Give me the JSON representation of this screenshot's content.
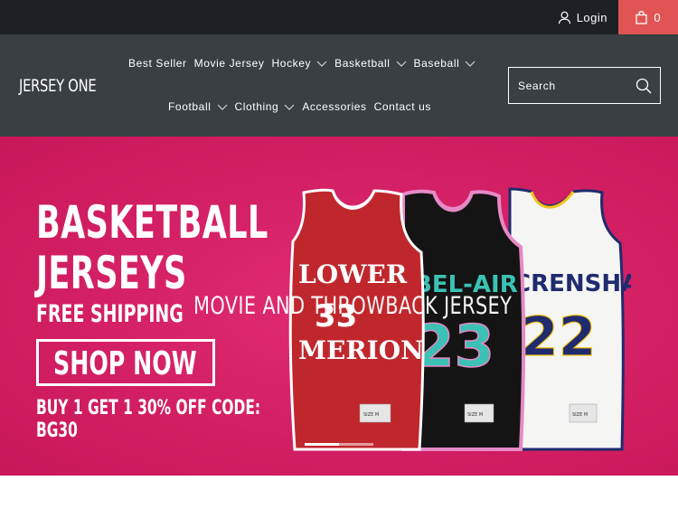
{
  "topbar": {
    "login_label": "Login",
    "cart_count": "0",
    "cart_color": "#e05553"
  },
  "header": {
    "logo": "JERSEY ONE",
    "nav_row1": [
      {
        "label": "Best Seller",
        "has_dropdown": false
      },
      {
        "label": "Movie Jersey",
        "has_dropdown": false
      },
      {
        "label": "Hockey",
        "has_dropdown": true
      },
      {
        "label": "Basketball",
        "has_dropdown": true
      },
      {
        "label": "Baseball",
        "has_dropdown": true
      }
    ],
    "nav_row2": [
      {
        "label": "Football",
        "has_dropdown": true
      },
      {
        "label": "Clothing",
        "has_dropdown": true
      },
      {
        "label": "Accessories",
        "has_dropdown": false
      },
      {
        "label": "Contact us",
        "has_dropdown": false
      }
    ],
    "search_placeholder": "Search"
  },
  "hero": {
    "headline1": "BASKETBALL",
    "headline2": "JERSEYS",
    "subline": "FREE SHIPPING",
    "button_label": "SHOP NOW",
    "offer_line1": "BUY 1 GET 1 30% OFF CODE:",
    "offer_line2": "BG30",
    "overlay_title": "MOVIE AND THROWBACK JERSEY",
    "background_color": "#d31f63",
    "jerseys": [
      {
        "name": "LOWER",
        "name2": "MERION",
        "number": "33",
        "color": "#c0272d"
      },
      {
        "name": "BEL-AIR",
        "number": "23",
        "color": "#111111"
      },
      {
        "name": "CRENSHAW",
        "number": "22",
        "color": "#f4f4f4"
      }
    ],
    "tag_text": "SIZE M",
    "slide_count": 2,
    "active_slide": 1
  }
}
